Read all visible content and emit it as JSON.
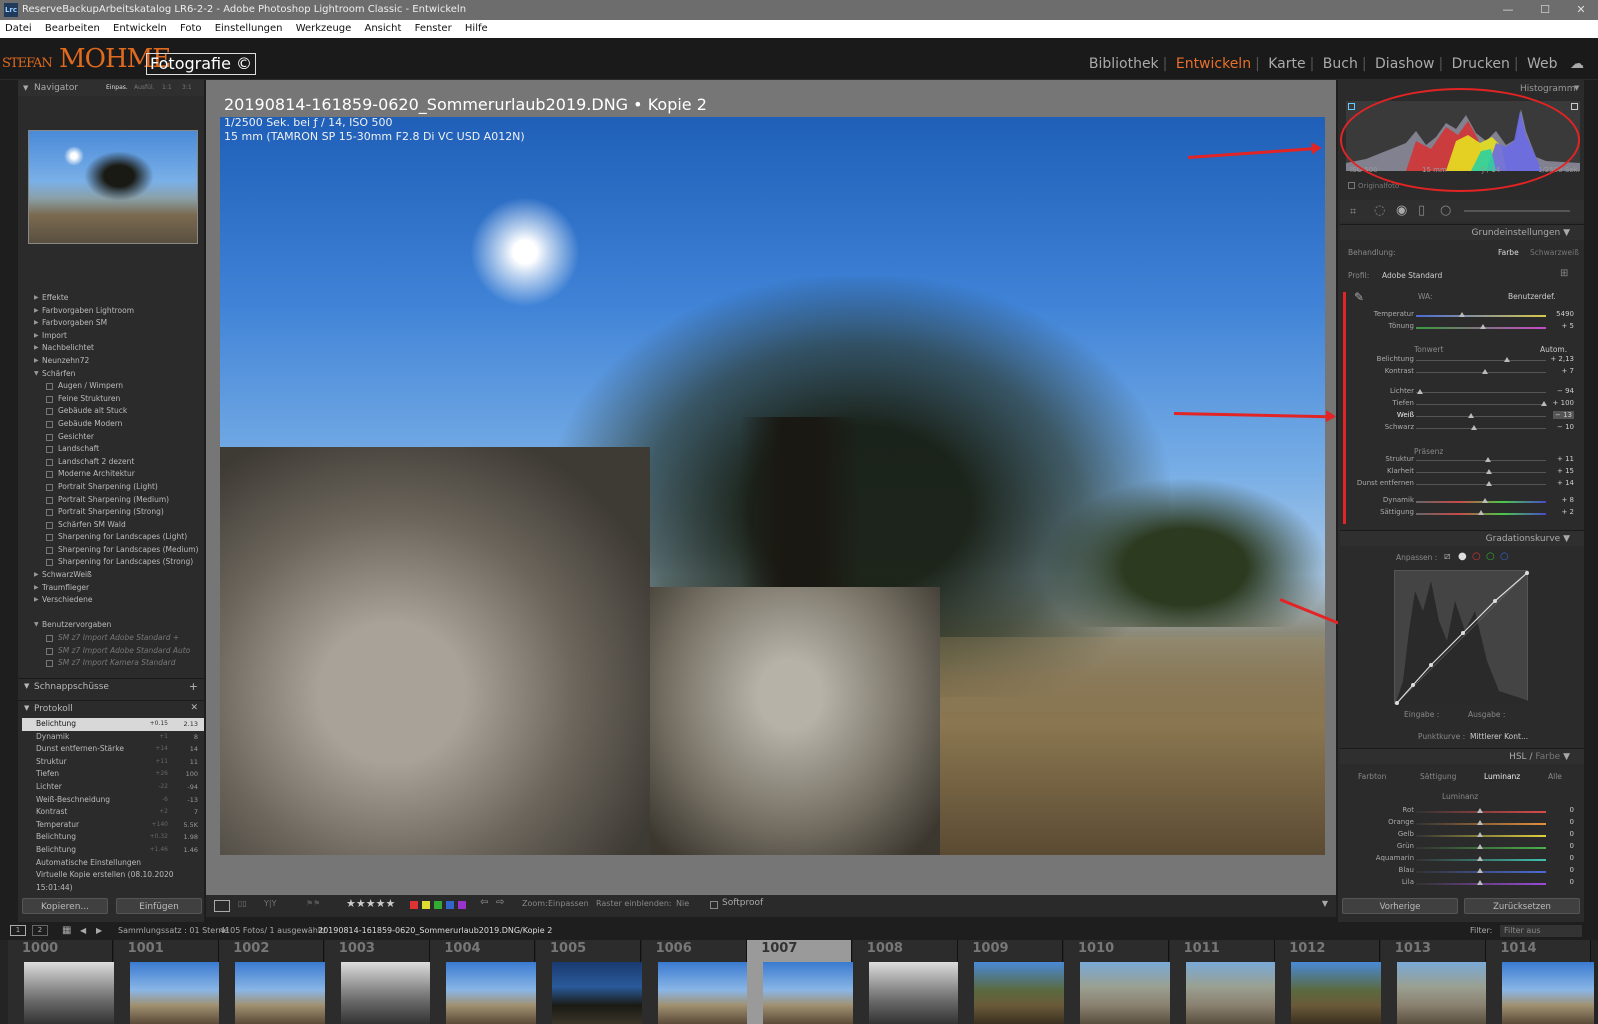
{
  "window": {
    "title": "ReserveBackupArbeitskatalog LR6-2-2 - Adobe Photoshop Lightroom Classic - Entwickeln",
    "app_icon": "Lrc",
    "minimize": "—",
    "maximize": "☐",
    "close": "✕"
  },
  "menu": [
    "Datei",
    "Bearbeiten",
    "Entwickeln",
    "Foto",
    "Einstellungen",
    "Werkzeuge",
    "Ansicht",
    "Fenster",
    "Hilfe"
  ],
  "identity_plate": {
    "name_a": "STEFAN",
    "name_b": "MOHME",
    "box": "Fotografie ©"
  },
  "modules": [
    {
      "label": "Bibliothek",
      "active": false
    },
    {
      "label": "Entwickeln",
      "active": true
    },
    {
      "label": "Karte",
      "active": false
    },
    {
      "label": "Buch",
      "active": false
    },
    {
      "label": "Diashow",
      "active": false
    },
    {
      "label": "Drucken",
      "active": false
    },
    {
      "label": "Web",
      "active": false
    }
  ],
  "left": {
    "navigator": {
      "label": "Navigator",
      "zoom": [
        "Einpas.",
        "Ausfül.",
        "1:1",
        "3:1"
      ]
    },
    "presets": [
      {
        "label": "Effekte",
        "level": 1,
        "expanded": false
      },
      {
        "label": "Farbvorgaben Lightroom",
        "level": 1,
        "expanded": false
      },
      {
        "label": "Farbvorgaben SM",
        "level": 1,
        "expanded": false
      },
      {
        "label": "Import",
        "level": 1,
        "expanded": false
      },
      {
        "label": "Nachbelichtet",
        "level": 1,
        "expanded": false
      },
      {
        "label": "Neunzehn72",
        "level": 1,
        "expanded": false
      },
      {
        "label": "Schärfen",
        "level": 1,
        "expanded": true
      },
      {
        "label": "Augen / Wimpern",
        "level": 2
      },
      {
        "label": "Feine Strukturen",
        "level": 2
      },
      {
        "label": "Gebäude alt Stuck",
        "level": 2
      },
      {
        "label": "Gebäude Modern",
        "level": 2
      },
      {
        "label": "Gesichter",
        "level": 2
      },
      {
        "label": "Landschaft",
        "level": 2
      },
      {
        "label": "Landschaft 2 dezent",
        "level": 2
      },
      {
        "label": "Moderne Architektur",
        "level": 2
      },
      {
        "label": "Portrait Sharpening (Light)",
        "level": 2
      },
      {
        "label": "Portrait Sharpening (Medium)",
        "level": 2
      },
      {
        "label": "Portrait Sharpening (Strong)",
        "level": 2
      },
      {
        "label": "Schärfen SM Wald",
        "level": 2
      },
      {
        "label": "Sharpening for Landscapes (Light)",
        "level": 2
      },
      {
        "label": "Sharpening for Landscapes (Medium)",
        "level": 2
      },
      {
        "label": "Sharpening for Landscapes (Strong)",
        "level": 2
      },
      {
        "label": "SchwarzWeiß",
        "level": 1,
        "expanded": false
      },
      {
        "label": "Traumflieger",
        "level": 1,
        "expanded": false
      },
      {
        "label": "Verschiedene",
        "level": 1,
        "expanded": false
      },
      {
        "label": "",
        "level": 0
      },
      {
        "label": "Benutzervorgaben",
        "level": 1,
        "expanded": true
      },
      {
        "label": "SM z7 Import Adobe Standard +",
        "level": 2,
        "dim": true
      },
      {
        "label": "SM z7 Import Adobe Standard Auto",
        "level": 2,
        "dim": true
      },
      {
        "label": "SM z7 Import Kamera Standard",
        "level": 2,
        "dim": true
      }
    ],
    "snapshots_label": "Schnappschüsse",
    "snapshots_add": "+",
    "history_label": "Protokoll",
    "history_close": "✕",
    "history": [
      {
        "label": "Belichtung",
        "a": "+0.15",
        "b": "2.13",
        "selected": true
      },
      {
        "label": "Dynamik",
        "a": "+1",
        "b": "8"
      },
      {
        "label": "Dunst entfernen-Stärke",
        "a": "+14",
        "b": "14"
      },
      {
        "label": "Struktur",
        "a": "+11",
        "b": "11"
      },
      {
        "label": "Tiefen",
        "a": "+26",
        "b": "100"
      },
      {
        "label": "Lichter",
        "a": "-22",
        "b": "-94"
      },
      {
        "label": "Weiß-Beschneidung",
        "a": "-6",
        "b": "-13"
      },
      {
        "label": "Kontrast",
        "a": "+2",
        "b": "7"
      },
      {
        "label": "Temperatur",
        "a": "+140",
        "b": "5.5K"
      },
      {
        "label": "Belichtung",
        "a": "+0.32",
        "b": "1.98"
      },
      {
        "label": "Belichtung",
        "a": "+1.46",
        "b": "1.46"
      },
      {
        "label": "Automatische Einstellungen",
        "a": "",
        "b": ""
      },
      {
        "label": "Virtuelle Kopie erstellen (08.10.2020 15:01:44)",
        "a": "",
        "b": ""
      }
    ],
    "copy_button": "Kopieren...",
    "paste_button": "Einfügen"
  },
  "photo": {
    "filename": "20190814-161859-0620_Sommerurlaub2019.DNG",
    "sep": "•",
    "copy": "Kopie 2",
    "info1": "1/2500 Sek. bei ƒ / 14, ISO 500",
    "info2": "15 mm (TAMRON SP 15-30mm F2.8 Di VC USD A012N)"
  },
  "toolbar": {
    "stars": "★★★★★",
    "zoom_label": "Zoom:",
    "zoom_value": "Einpassen",
    "grid_label": "Raster einblenden:",
    "grid_value": "Nie",
    "softproof": "Softproof"
  },
  "right": {
    "histogram_label": "Histogramm",
    "histo_info": [
      "ISO 500",
      "15 mm",
      "ƒ / 14",
      "1/2500 Sek."
    ],
    "original_photo": "Originalfoto",
    "basic_label": "Grundeinstellungen",
    "treatment_label": "Behandlung:",
    "treatment_color": "Farbe",
    "treatment_bw": "Schwarzweiß",
    "profile_label": "Profil:",
    "profile_value": "Adobe Standard",
    "wb_label": "WA:",
    "wb_value": "Benutzerdef.",
    "tone_label": "Tonwert",
    "auto_label": "Autom.",
    "presence_label": "Präsenz",
    "sliders": [
      {
        "label": "Temperatur",
        "value": "5490",
        "pos": 0.36
      },
      {
        "label": "Tönung",
        "value": "+ 5",
        "pos": 0.52
      },
      {
        "label": "Belichtung",
        "value": "+ 2,13",
        "pos": 0.71
      },
      {
        "label": "Kontrast",
        "value": "+ 7",
        "pos": 0.54
      },
      {
        "label": "Lichter",
        "value": "− 94",
        "pos": 0.03
      },
      {
        "label": "Tiefen",
        "value": "+ 100",
        "pos": 1.0
      },
      {
        "label": "Weiß",
        "value": "− 13",
        "pos": 0.43
      },
      {
        "label": "Schwarz",
        "value": "− 10",
        "pos": 0.45
      },
      {
        "label": "Struktur",
        "value": "+ 11",
        "pos": 0.56
      },
      {
        "label": "Klarheit",
        "value": "+ 15",
        "pos": 0.57
      },
      {
        "label": "Dunst entfernen",
        "value": "+ 14",
        "pos": 0.57
      },
      {
        "label": "Dynamik",
        "value": "+ 8",
        "pos": 0.54
      },
      {
        "label": "Sättigung",
        "value": "+ 2",
        "pos": 0.51
      }
    ],
    "curve_label": "Gradationskurve",
    "curve_adjust": "Anpassen :",
    "curve_input": "Eingabe :",
    "curve_output": "Ausgabe :",
    "curve_point_label": "Punktkurve :",
    "curve_point_value": "Mittlerer Kont...",
    "hsl_label": "HSL",
    "hsl_sep": "/",
    "hsl_color": "Farbe",
    "hsl_tabs": [
      "Farbton",
      "Sättigung",
      "Luminanz",
      "Alle"
    ],
    "hsl_active": "Luminanz",
    "hsl_section": "Luminanz",
    "hsl_rows": [
      {
        "label": "Rot",
        "value": "0"
      },
      {
        "label": "Orange",
        "value": "0"
      },
      {
        "label": "Gelb",
        "value": "0"
      },
      {
        "label": "Grün",
        "value": "0"
      },
      {
        "label": "Aquamarin",
        "value": "0"
      },
      {
        "label": "Blau",
        "value": "0"
      },
      {
        "label": "Lila",
        "value": "0"
      }
    ],
    "prev_button": "Vorherige",
    "reset_button": "Zurücksetzen"
  },
  "filmstrip_bar": {
    "view1": "1",
    "view2": "2",
    "source": "Sammlungssatz : 01 Sterne",
    "count": "4105 Fotos/ 1 ausgewählt/",
    "path": "20190814-161859-0620_Sommerurlaub2019.DNG/Kopie 2",
    "filter_label": "Filter:",
    "filter_value": "Filter aus"
  },
  "filmstrip": [
    {
      "num": "1000",
      "tone": "bw"
    },
    {
      "num": "1001",
      "tone": "color"
    },
    {
      "num": "1002",
      "tone": "color"
    },
    {
      "num": "1003",
      "tone": "bw"
    },
    {
      "num": "1004",
      "tone": "color"
    },
    {
      "num": "1005",
      "tone": "dark"
    },
    {
      "num": "1006",
      "tone": "color"
    },
    {
      "num": "1007",
      "tone": "color",
      "selected": true
    },
    {
      "num": "1008",
      "tone": "bw"
    },
    {
      "num": "1009",
      "tone": "tree"
    },
    {
      "num": "1010",
      "tone": "rocks"
    },
    {
      "num": "1011",
      "tone": "rocks"
    },
    {
      "num": "1012",
      "tone": "tree"
    },
    {
      "num": "1013",
      "tone": "rocks"
    },
    {
      "num": "1014",
      "tone": "color"
    }
  ],
  "colors": {
    "accent": "#e8702a",
    "annotation": "#e22424",
    "panel": "#2b2b2b",
    "background": "#767676"
  }
}
